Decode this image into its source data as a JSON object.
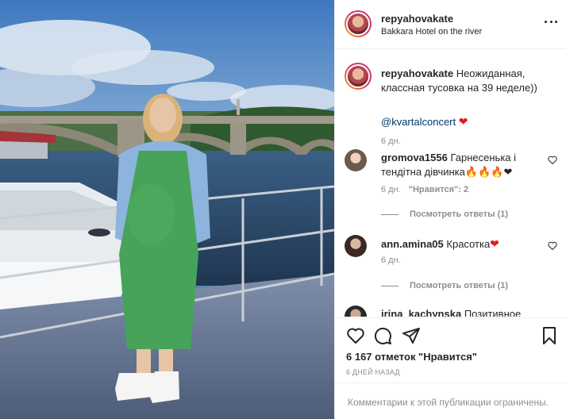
{
  "post": {
    "username": "repyahovakate",
    "location": "Bakkara Hotel on the river"
  },
  "caption": {
    "username": "repyahovakate",
    "text": "Неожиданная, классная тусовка на 39 неделе))",
    "mention": "@kvartalconcert",
    "emoji": "❤",
    "time": "6 дн."
  },
  "comments": [
    {
      "username": "gromova1556",
      "text": "Гарнесенька і тендітна дівчинка",
      "emoji": "🔥🔥🔥❤",
      "time": "6 дн.",
      "likes": "\"Нравится\": 2",
      "replies": "Посмотреть ответы (1)"
    },
    {
      "username": "ann.amina05",
      "text": "Красотка",
      "emoji": "❤",
      "time": "6 дн.",
      "replies": "Посмотреть ответы (1)"
    },
    {
      "username": "irina_kachynska",
      "text": "Позитивное"
    }
  ],
  "stats": {
    "likes": "6 167 отметок \"Нравится\"",
    "posted": "6 ДНЕЙ НАЗАД"
  },
  "footer": {
    "notice": "Комментарии к этой публикации ограничены."
  },
  "icons": {
    "more": "more-options-icon",
    "like": "heart-icon",
    "comment": "comment-icon",
    "share": "share-icon",
    "save": "bookmark-icon"
  }
}
